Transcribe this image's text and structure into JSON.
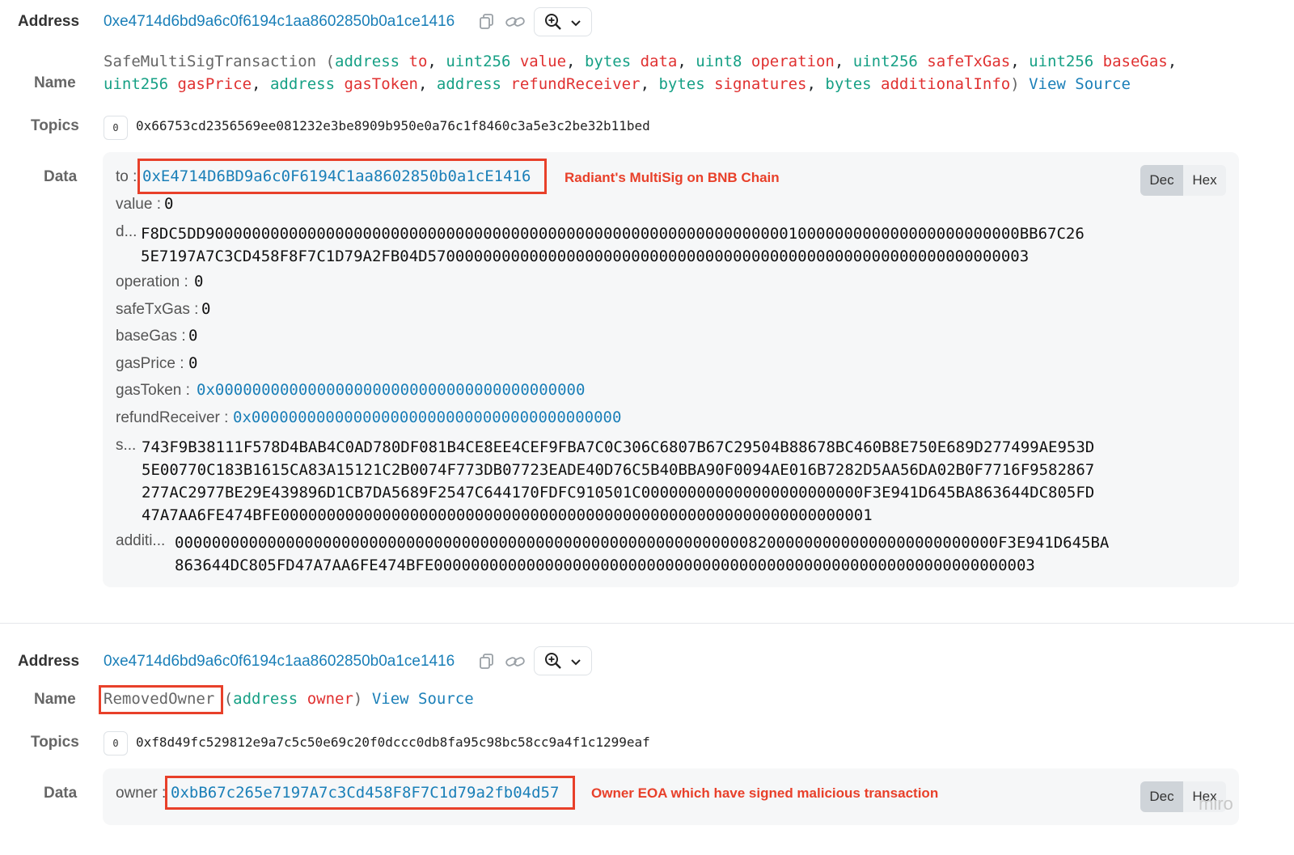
{
  "log1": {
    "address_label": "Address",
    "address": "0xe4714d6bd9a6c0f6194c1aa8602850b0a1ce1416",
    "name_label": "Name",
    "signature": {
      "fn": "SafeMultiSigTransaction",
      "open": " (",
      "params": [
        {
          "type": "address",
          "name": "to"
        },
        {
          "type": "uint256",
          "name": "value"
        },
        {
          "type": "bytes",
          "name": "data"
        },
        {
          "type": "uint8",
          "name": "operation"
        },
        {
          "type": "uint256",
          "name": "safeTxGas"
        },
        {
          "type": "uint256",
          "name": "baseGas"
        },
        {
          "type": "uint256",
          "name": "gasPrice"
        },
        {
          "type": "address",
          "name": "gasToken"
        },
        {
          "type": "address",
          "name": "refundReceiver"
        },
        {
          "type": "bytes",
          "name": "signatures"
        },
        {
          "type": "bytes",
          "name": "additionalInfo"
        }
      ],
      "close": ")",
      "view_source": "View Source"
    },
    "topics_label": "Topics",
    "topics": [
      {
        "index": "0",
        "hash": "0x66753cd2356569ee081232e3be8909b950e0a76c1f8460c3a5e3c2be32b11bed"
      }
    ],
    "data_label": "Data",
    "fields": {
      "to_label": "to :",
      "to_value": "0xE4714D6BD9a6c0F6194C1aa8602850b0a1cE1416",
      "to_note": "Radiant's MultiSig on BNB Chain",
      "value_label": "value :",
      "value_value": "0",
      "data_label": "d...",
      "data_value_1": "F8DC5DD9000000000000000000000000000000000000000000000000000000000000001000000000000000000000000BB67C26",
      "data_value_2": "5E7197A7C3CD458F8F7C1D79A2FB04D57000000000000000000000000000000000000000000000000000000000000003",
      "operation_label": "operation :",
      "operation_value": "0",
      "safeTxGas_label": "safeTxGas :",
      "safeTxGas_value": "0",
      "baseGas_label": "baseGas :",
      "baseGas_value": "0",
      "gasPrice_label": "gasPrice :",
      "gasPrice_value": "0",
      "gasToken_label": "gasToken :",
      "gasToken_value": "0x0000000000000000000000000000000000000000",
      "refundReceiver_label": "refundReceiver :",
      "refundReceiver_value": "0x0000000000000000000000000000000000000000",
      "signatures_label": "s...",
      "signatures_value_1": "743F9B38111F578D4BAB4C0AD780DF081B4CE8EE4CEF9FBA7C0C306C6807B67C29504B88678BC460B8E750E689D277499AE953D",
      "signatures_value_2": "5E00770C183B1615CA83A15121C2B0074F773DB07723EADE40D76C5B40BBA90F0094AE016B7282D5AA56DA02B0F7716F9582867",
      "signatures_value_3": "277AC2977BE29E439896D1CB7DA5689F2547C644170FDFC910501C000000000000000000000000F3E941D645BA863644DC805FD",
      "signatures_value_4": "47A7AA6FE474BFE0000000000000000000000000000000000000000000000000000000000000001",
      "additional_label": "additi...",
      "additional_value_1": "00000000000000000000000000000000000000000000000000000000000000820000000000000000000000000F3E941D645BA",
      "additional_value_2": "863644DC805FD47A7AA6FE474BFE00000000000000000000000000000000000000000000000000000000000000003"
    },
    "toggle": {
      "dec": "Dec",
      "hex": "Hex"
    }
  },
  "log2": {
    "address_label": "Address",
    "address": "0xe4714d6bd9a6c0f6194c1aa8602850b0a1ce1416",
    "name_label": "Name",
    "signature": {
      "fn": "RemovedOwner",
      "open": " (",
      "param_type": "address",
      "param_name": "owner",
      "close": ")",
      "view_source": "View Source"
    },
    "topics_label": "Topics",
    "topics": [
      {
        "index": "0",
        "hash": "0xf8d49fc529812e9a7c5c50e69c20f0dccc0db8fa95c98bc58cc9a4f1c1299eaf"
      }
    ],
    "data_label": "Data",
    "fields": {
      "owner_label": "owner :",
      "owner_value": "0xbB67c265e7197A7c3Cd458F8F7C1d79a2fb04d57",
      "owner_note": "Owner EOA which have signed malicious transaction"
    },
    "toggle": {
      "dec": "Dec",
      "hex": "Hex"
    }
  },
  "watermark": "miro",
  "colors": {
    "link": "#1a7fb8",
    "type": "#16a085",
    "param_name": "#e03131",
    "highlight": "#e8402a"
  },
  "icons": [
    "copy-icon",
    "link-icon",
    "zoom-in-icon",
    "chevron-down-icon"
  ]
}
